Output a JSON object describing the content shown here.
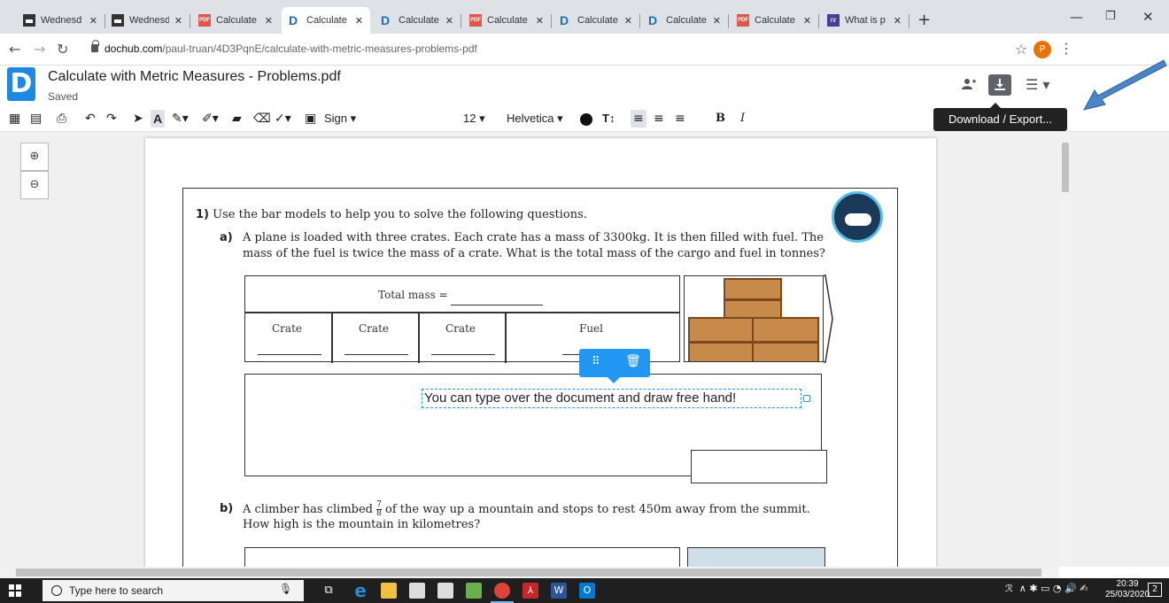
{
  "browser": {
    "tabs": [
      {
        "title": "Wednesd",
        "icon": "image-icon"
      },
      {
        "title": "Wednesd",
        "icon": "image-icon"
      },
      {
        "title": "Calculate",
        "icon": "pdf-icon"
      },
      {
        "title": "Calculate",
        "icon": "dochub-icon",
        "active": true
      },
      {
        "title": "Calculate",
        "icon": "dochub-icon"
      },
      {
        "title": "Calculate",
        "icon": "pdf-icon"
      },
      {
        "title": "Calculate",
        "icon": "dochub-icon"
      },
      {
        "title": "Calculate",
        "icon": "dochub-icon"
      },
      {
        "title": "Calculate",
        "icon": "pdf-icon"
      },
      {
        "title": "What is p",
        "icon": "nr-icon"
      }
    ],
    "tab_close": "✕",
    "new_tab": "+",
    "url_host": "dochub.com",
    "url_path": "/paul-truan/4D3PqnE/calculate-with-metric-measures-problems-pdf",
    "profile_initial": "P"
  },
  "app": {
    "logo": "D",
    "doc_title": "Calculate with Metric Measures - Problems.pdf",
    "save_status": "Saved",
    "tooltip": "Download / Export..."
  },
  "toolbar": {
    "sign_label": "Sign",
    "font_size": "12",
    "font_name": "Helvetica",
    "bold": "B",
    "italic": "I",
    "text_tool": "A"
  },
  "document": {
    "q1_num": "1)",
    "q1_text": "Use the bar models to help you to solve the following questions.",
    "qa_label": "a)",
    "qa_line1": "A plane is loaded with three crates. Each crate has a mass of 3300kg. It is then filled with fuel. The",
    "qa_line2": "mass of the fuel is twice the mass of a crate. What is the total mass of the cargo and fuel in tonnes?",
    "total_mass": "Total mass =",
    "cells": [
      "Crate",
      "Crate",
      "Crate",
      "Fuel"
    ],
    "free_text": "You can type over the document and draw free hand!",
    "qb_label": "b)",
    "qb_line1_pre": "A climber has climbed",
    "qb_frac_num": "7",
    "qb_frac_den": "8",
    "qb_line1_post": "of the way up a mountain and stops to rest 450m away from the summit.",
    "qb_line2": "How high is the mountain in kilometres?"
  },
  "taskbar": {
    "search_placeholder": "Type here to search",
    "time": "20:39",
    "date": "25/03/2020",
    "notification_count": "2"
  },
  "colors": {
    "accent": "#2196f3",
    "annotation_arrow": "#4a86c8"
  }
}
